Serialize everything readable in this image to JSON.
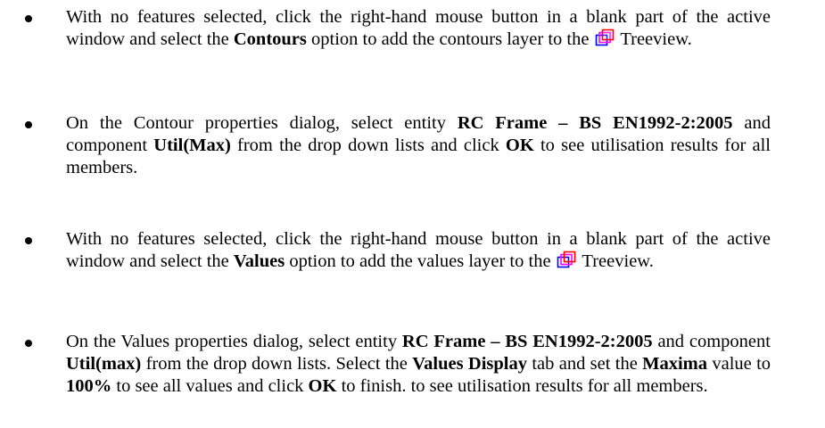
{
  "colors": {
    "text": "#000000",
    "icon_back": "#0000ff",
    "icon_mid": "#ff00ff",
    "icon_front": "#ff0000"
  },
  "icons": {
    "treeview": "layers-icon"
  },
  "bullets": [
    {
      "t1": "With no features selected, click the right-hand mouse button in a blank part of the active window and select the ",
      "b1": "Contours",
      "t2": " option to add the contours layer to the ",
      "t3": " Treeview."
    },
    {
      "t1": "On the Contour properties dialog, select entity ",
      "b1": "RC Frame – BS EN1992-2:2005",
      "t2": " and component ",
      "b2": "Util(Max)",
      "t3": " from the drop down lists and click ",
      "b3": "OK",
      "t4": " to see utilisation results for all members."
    },
    {
      "t1": "With no features selected, click the right-hand mouse button in a blank part of the active window and select the ",
      "b1": "Values",
      "t2": " option to add the values layer to the ",
      "t3": " Treeview."
    },
    {
      "t1": "On the Values properties dialog, select entity ",
      "b1": "RC Frame – BS EN1992-2:2005",
      "t2": " and component ",
      "b2": "Util(max)",
      "t3": " from the drop down lists. Select the ",
      "b3": "Values Display",
      "t4": " tab and set the ",
      "b4": "Maxima",
      "t5": " value to ",
      "b5": "100%",
      "t6": " to see all values and click ",
      "b6": "OK",
      "t7": " to finish. to see utilisation results for all members."
    }
  ]
}
